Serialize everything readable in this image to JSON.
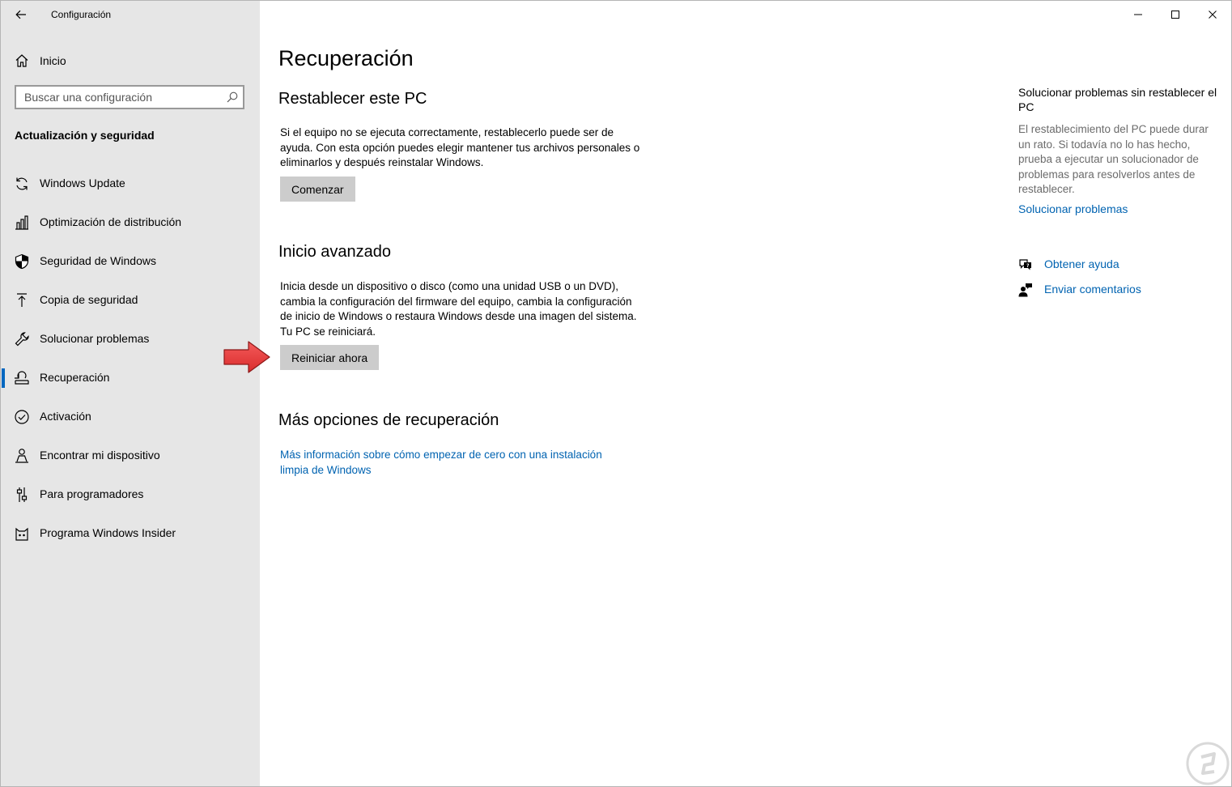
{
  "window": {
    "title": "Configuración",
    "controls": {
      "minimize": "minimize-icon",
      "maximize": "maximize-icon",
      "close": "close-icon"
    }
  },
  "sidebar": {
    "home_label": "Inicio",
    "search_placeholder": "Buscar una configuración",
    "section_header": "Actualización y seguridad",
    "items": [
      {
        "label": "Windows Update",
        "icon": "sync-icon"
      },
      {
        "label": "Optimización de distribución",
        "icon": "delivery-optimization-icon"
      },
      {
        "label": "Seguridad de Windows",
        "icon": "shield-icon"
      },
      {
        "label": "Copia de seguridad",
        "icon": "backup-arrow-icon"
      },
      {
        "label": "Solucionar problemas",
        "icon": "wrench-icon"
      },
      {
        "label": "Recuperación",
        "icon": "recovery-icon",
        "active": true
      },
      {
        "label": "Activación",
        "icon": "check-circle-icon"
      },
      {
        "label": "Encontrar mi dispositivo",
        "icon": "person-pin-icon"
      },
      {
        "label": "Para programadores",
        "icon": "developer-sliders-icon"
      },
      {
        "label": "Programa Windows Insider",
        "icon": "insider-cat-icon"
      }
    ]
  },
  "main": {
    "page_title": "Recuperación",
    "reset": {
      "heading": "Restablecer este PC",
      "description": "Si el equipo no se ejecuta correctamente, restablecerlo puede ser de ayuda. Con esta opción puedes elegir mantener tus archivos personales o eliminarlos y después reinstalar Windows.",
      "button": "Comenzar"
    },
    "advanced": {
      "heading": "Inicio avanzado",
      "description": "Inicia desde un dispositivo o disco (como una unidad USB o un DVD), cambia la configuración del firmware del equipo, cambia la configuración de inicio de Windows o restaura Windows desde una imagen del sistema. Tu PC se reiniciará.",
      "button": "Reiniciar ahora"
    },
    "more": {
      "heading": "Más opciones de recuperación",
      "link": "Más información sobre cómo empezar de cero con una instalación limpia de Windows"
    }
  },
  "side_panel": {
    "title": "Solucionar problemas sin restablecer el PC",
    "description": "El restablecimiento del PC puede durar un rato. Si todavía no lo has hecho, prueba a ejecutar un solucionador de problemas para resolverlos antes de restablecer.",
    "link": "Solucionar problemas",
    "help": [
      {
        "label": "Obtener ayuda",
        "icon": "help-chat-icon"
      },
      {
        "label": "Enviar comentarios",
        "icon": "feedback-icon"
      }
    ]
  },
  "colors": {
    "accent": "#0063b1",
    "sidebar_bg": "#e6e6e6",
    "button_bg": "#cccccc",
    "annotation_arrow": "#e8393a"
  }
}
